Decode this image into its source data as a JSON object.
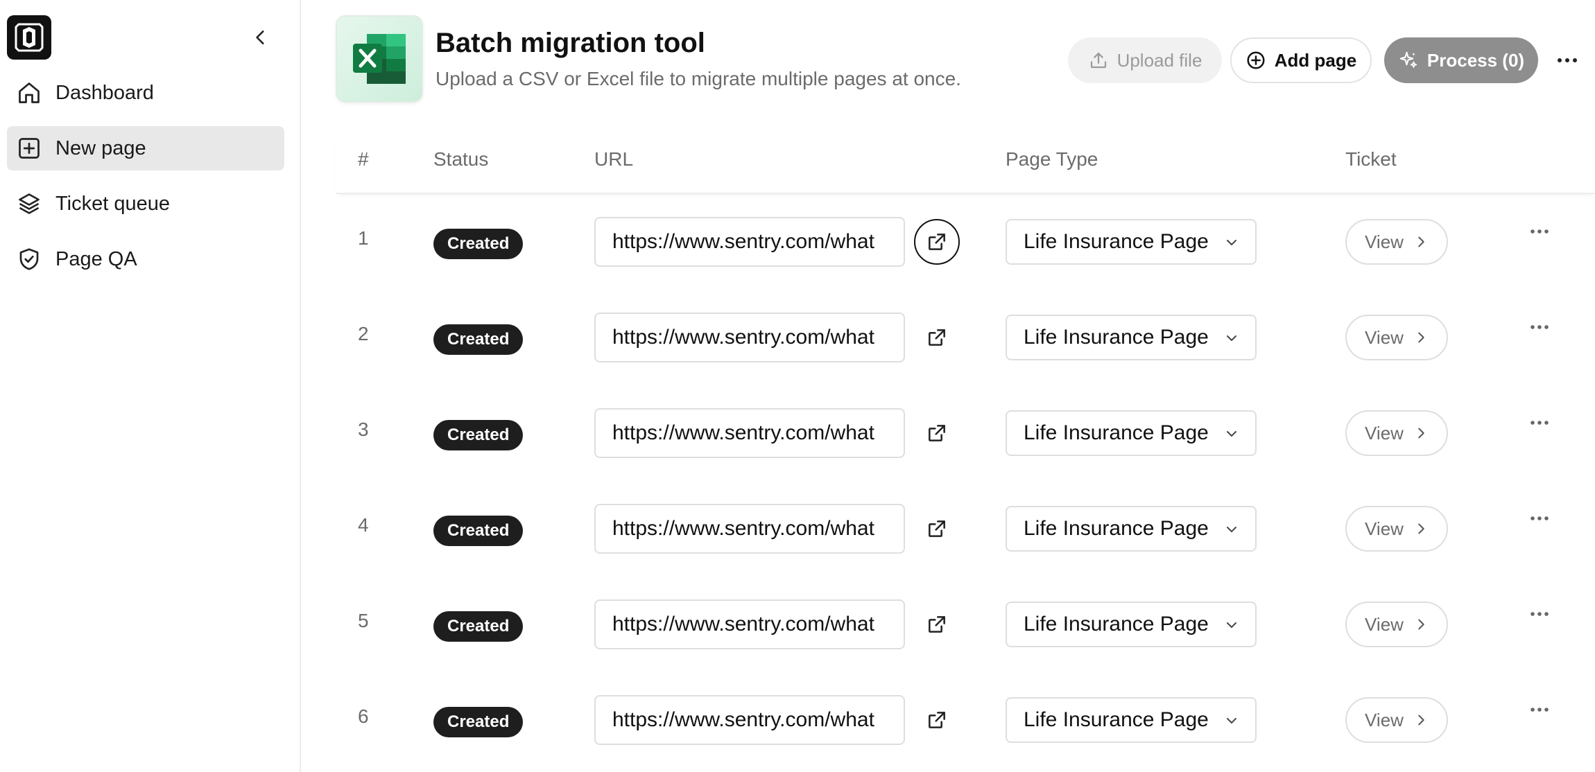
{
  "sidebar": {
    "items": [
      {
        "label": "Dashboard",
        "icon": "home-icon",
        "active": false
      },
      {
        "label": "New page",
        "icon": "plus-square-icon",
        "active": true
      },
      {
        "label": "Ticket queue",
        "icon": "layers-icon",
        "active": false
      },
      {
        "label": "Page QA",
        "icon": "shield-check-icon",
        "active": false
      }
    ]
  },
  "header": {
    "app_icon": "excel-icon",
    "title": "Batch migration tool",
    "subtitle": "Upload a CSV or Excel file to migrate multiple pages at once.",
    "upload_label": "Upload file",
    "add_label": "Add page",
    "process_label": "Process (0)"
  },
  "table": {
    "columns": [
      "#",
      "Status",
      "URL",
      "Page Type",
      "Ticket"
    ],
    "rows": [
      {
        "num": "1",
        "status": "Created",
        "url": "https://www.sentry.com/what",
        "page_type": "Life Insurance Page",
        "ticket": "View"
      },
      {
        "num": "2",
        "status": "Created",
        "url": "https://www.sentry.com/what",
        "page_type": "Life Insurance Page",
        "ticket": "View"
      },
      {
        "num": "3",
        "status": "Created",
        "url": "https://www.sentry.com/what",
        "page_type": "Life Insurance Page",
        "ticket": "View"
      },
      {
        "num": "4",
        "status": "Created",
        "url": "https://www.sentry.com/what",
        "page_type": "Life Insurance Page",
        "ticket": "View"
      },
      {
        "num": "5",
        "status": "Created",
        "url": "https://www.sentry.com/what",
        "page_type": "Life Insurance Page",
        "ticket": "View"
      },
      {
        "num": "6",
        "status": "Created",
        "url": "https://www.sentry.com/what",
        "page_type": "Life Insurance Page",
        "ticket": "View"
      }
    ]
  },
  "colors": {
    "accent_dark": "#1e1e1e",
    "process_button": "#8e8e8e",
    "excel_green": "#1f7a45"
  }
}
